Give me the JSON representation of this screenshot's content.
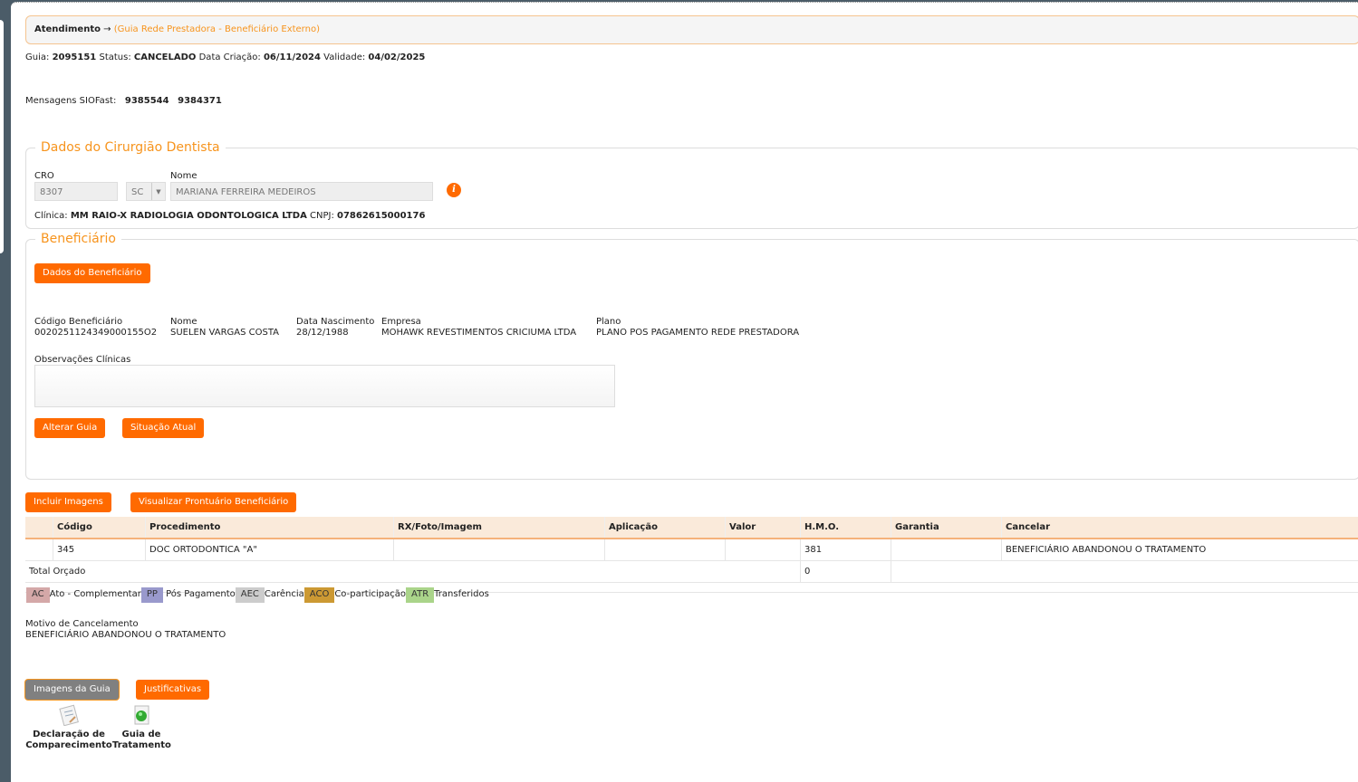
{
  "breadcrumb": {
    "root": "Atendimento",
    "arrow": "→",
    "sub": "(Guia Rede Prestadora - Beneficiário Externo)"
  },
  "guia": {
    "guia_label": "Guia:",
    "guia": "2095151",
    "status_label": "Status:",
    "status": "CANCELADO",
    "criacao_label": "Data Criação:",
    "criacao": "06/11/2024",
    "validade_label": "Validade:",
    "validade": "04/02/2025"
  },
  "siofast": {
    "label": "Mensagens SIOFast:",
    "msg1": "9385544",
    "msg2": "9384371"
  },
  "dentista": {
    "legend": "Dados do Cirurgião Dentista",
    "cro_label": "CRO",
    "cro": "8307",
    "uf": "SC",
    "nome_label": "Nome",
    "nome": "MARIANA FERREIRA MEDEIROS",
    "clinica_label": "Clínica:",
    "clinica": "MM RAIO-X RADIOLOGIA ODONTOLOGICA LTDA",
    "cnpj_label": "CNPJ:",
    "cnpj": "07862615000176"
  },
  "beneficiario": {
    "legend": "Beneficiário",
    "dados_btn": "Dados do Beneficiário",
    "codigo_label": "Código Beneficiário",
    "codigo": "0020251124349000155O2",
    "nome_label": "Nome",
    "nome": "SUELEN VARGAS COSTA",
    "nasc_label": "Data Nascimento",
    "nasc": "28/12/1988",
    "empresa_label": "Empresa",
    "empresa": "MOHAWK REVESTIMENTOS CRICIUMA LTDA",
    "plano_label": "Plano",
    "plano": "PLANO POS PAGAMENTO REDE PRESTADORA",
    "obs_label": "Observações Clínicas",
    "obs": "",
    "alterar_btn": "Alterar Guia",
    "situacao_btn": "Situação Atual"
  },
  "actions": {
    "incluir": "Incluir Imagens",
    "prontuario": "Visualizar Prontuário Beneficiário"
  },
  "table": {
    "headers": [
      "",
      "Código",
      "Procedimento",
      "RX/Foto/Imagem",
      "Aplicação",
      "Valor",
      "H.M.O.",
      "Garantia",
      "Cancelar"
    ],
    "rows": [
      [
        "",
        "345",
        "DOC ORTODONTICA \"A\"",
        "",
        "",
        "",
        "381",
        "",
        "BENEFICIÁRIO ABANDONOU O TRATAMENTO"
      ]
    ],
    "total_label": "Total Orçado",
    "total_hmo": "0"
  },
  "legend": [
    {
      "code": "AC",
      "label": "Ato - Complementar",
      "color": "#d4a8a8"
    },
    {
      "code": "PP",
      "label": "Pós Pagamento",
      "color": "#9999cc"
    },
    {
      "code": "AEC",
      "label": "Carência",
      "color": "#cccccc"
    },
    {
      "code": "ACO",
      "label": "Co-participação",
      "color": "#cc9933"
    },
    {
      "code": "ATR",
      "label": "Transferidos",
      "color": "#aad48a"
    }
  ],
  "cancel": {
    "label": "Motivo de Cancelamento",
    "value": "BENEFICIÁRIO ABANDONOU O TRATAMENTO"
  },
  "bottom": {
    "imagens_btn": "Imagens da Guia",
    "justificativas_btn": "Justificativas",
    "doc1_line1": "Declaração de",
    "doc1_line2": "Comparecimento",
    "doc2_line1": "Guia de",
    "doc2_line2": "Tratamento"
  }
}
